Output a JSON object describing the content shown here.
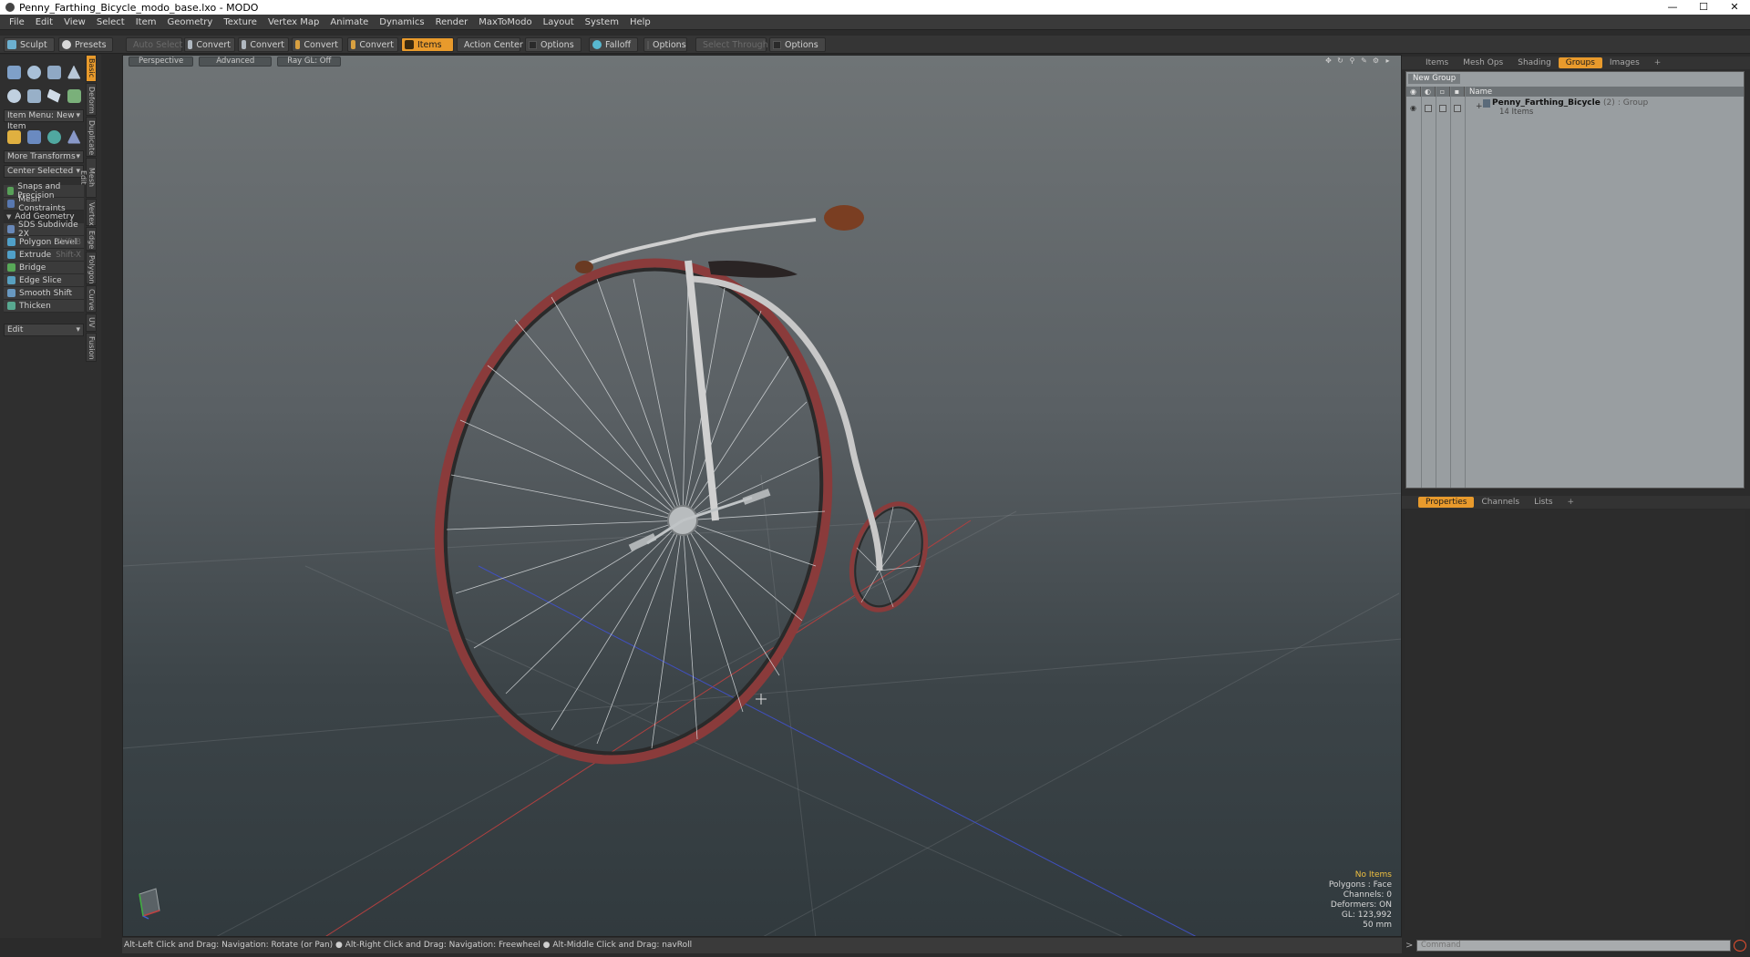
{
  "window": {
    "title": "Penny_Farthing_Bicycle_modo_base.lxo - MODO",
    "controls": [
      "—",
      "☐",
      "✕"
    ]
  },
  "menu": [
    "File",
    "Edit",
    "View",
    "Select",
    "Item",
    "Geometry",
    "Texture",
    "Vertex Map",
    "Animate",
    "Dynamics",
    "Render",
    "MaxToModo",
    "Layout",
    "System",
    "Help"
  ],
  "toolbar": {
    "sculpt": "Sculpt",
    "presets": "Presets",
    "auto_select": "Auto Select",
    "convert": "Convert",
    "items": "Items",
    "action_center": "Action Center",
    "options": "Options",
    "falloff": "Falloff",
    "select_through": "Select Through"
  },
  "toolbox": {
    "item_menu": "Item Menu: New Item",
    "more_transforms": "More Transforms",
    "center_selected": "Center Selected",
    "snaps": "Snaps and Precision",
    "mesh_constraints": "Mesh Constraints",
    "add_geometry": "Add Geometry",
    "tools": [
      {
        "label": "SDS Subdivide 2X",
        "shortcut": ""
      },
      {
        "label": "Polygon Bevel",
        "shortcut": "Shift-B"
      },
      {
        "label": "Extrude",
        "shortcut": "Shift-X"
      },
      {
        "label": "Bridge",
        "shortcut": ""
      },
      {
        "label": "Edge Slice",
        "shortcut": ""
      },
      {
        "label": "Smooth Shift",
        "shortcut": ""
      },
      {
        "label": "Thicken",
        "shortcut": ""
      }
    ],
    "edit": "Edit",
    "vtabs": [
      "Basic",
      "Deform",
      "Duplicate",
      "Mesh Edit",
      "Vertex",
      "Edge",
      "Polygon",
      "Curve",
      "UV",
      "Fusion"
    ]
  },
  "viewport": {
    "view": "Perspective",
    "shading": "Advanced",
    "raygl": "Ray GL: Off",
    "stats": {
      "items": "No Items",
      "polygons": "Polygons : Face",
      "channels": "Channels: 0",
      "deformers": "Deformers: ON",
      "gl": "GL: 123,992",
      "lens": "50 mm"
    }
  },
  "status": "Alt-Left Click and Drag: Navigation: Rotate (or Pan) ● Alt-Right Click and Drag: Navigation: Freewheel ● Alt-Middle Click and Drag: navRoll",
  "right": {
    "top_tabs": [
      "Items",
      "Mesh Ops",
      "Shading",
      "Groups",
      "Images",
      "+"
    ],
    "active_top_tab": "Groups",
    "new_group": "New Group",
    "name_col": "Name",
    "group": {
      "name": "Penny_Farthing_Bicycle",
      "count": "(2)",
      "type": ": Group",
      "items": "14 Items"
    },
    "bottom_tabs": [
      "Properties",
      "Channels",
      "Lists",
      "+"
    ],
    "command_placeholder": "Command"
  },
  "colors": {
    "accent": "#e89a2c",
    "tire": "#8a3b3b",
    "frame": "#c8c8c8",
    "grip": "#7a3e22"
  }
}
